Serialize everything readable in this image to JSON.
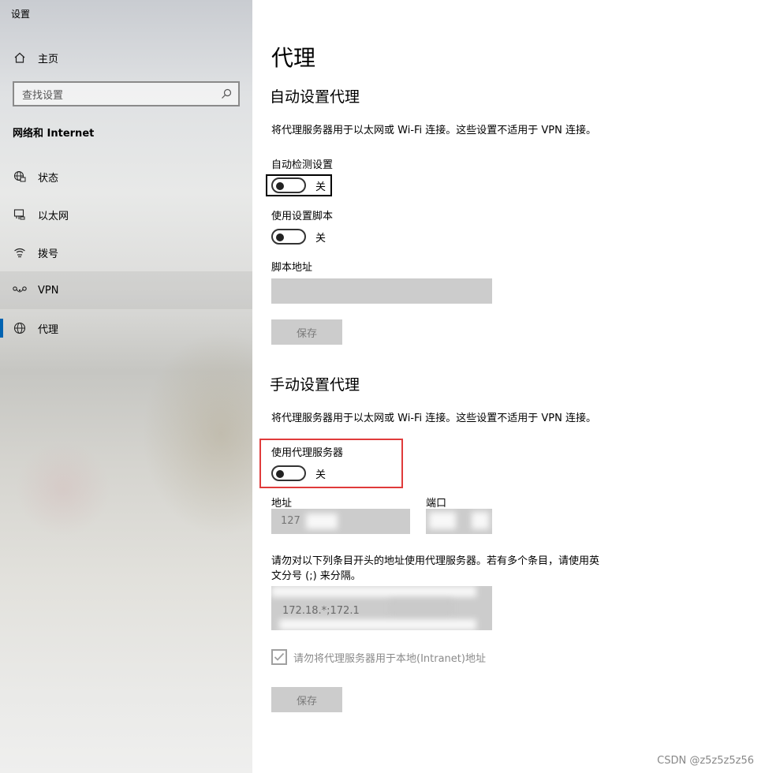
{
  "window": {
    "title": "设置"
  },
  "sidebar": {
    "home_label": "主页",
    "search_placeholder": "查找设置",
    "section_title": "网络和 Internet",
    "items": [
      {
        "label": "状态",
        "icon": "globe-status-icon"
      },
      {
        "label": "以太网",
        "icon": "ethernet-icon"
      },
      {
        "label": "拨号",
        "icon": "dialup-icon"
      },
      {
        "label": "VPN",
        "icon": "vpn-icon"
      },
      {
        "label": "代理",
        "icon": "globe-icon",
        "active": true
      }
    ]
  },
  "main": {
    "page_title": "代理",
    "auto": {
      "heading": "自动设置代理",
      "description": "将代理服务器用于以太网或 Wi-Fi 连接。这些设置不适用于 VPN 连接。",
      "detect_label": "自动检测设置",
      "detect_state": "关",
      "script_label": "使用设置脚本",
      "script_state": "关",
      "address_label": "脚本地址",
      "address_value": "",
      "save_label": "保存"
    },
    "manual": {
      "heading": "手动设置代理",
      "description": "将代理服务器用于以太网或 Wi-Fi 连接。这些设置不适用于 VPN 连接。",
      "use_proxy_label": "使用代理服务器",
      "use_proxy_state": "关",
      "address_label": "地址",
      "address_value": "127",
      "port_label": "端口",
      "port_value": "",
      "exceptions_desc_line1": "请勿对以下列条目开头的地址使用代理服务器。若有多个条目，请使用英",
      "exceptions_desc_line2": "文分号 (;) 来分隔。",
      "exceptions_value": "172.18.*;172.1",
      "local_bypass_label": "请勿将代理服务器用于本地(Intranet)地址",
      "local_bypass_checked": true,
      "save_label": "保存"
    }
  },
  "watermark": "CSDN @z5z5z5z56",
  "colors": {
    "accent": "#0063b1",
    "highlight_red": "#e03b3b",
    "disabled_bg": "#cccccc"
  }
}
